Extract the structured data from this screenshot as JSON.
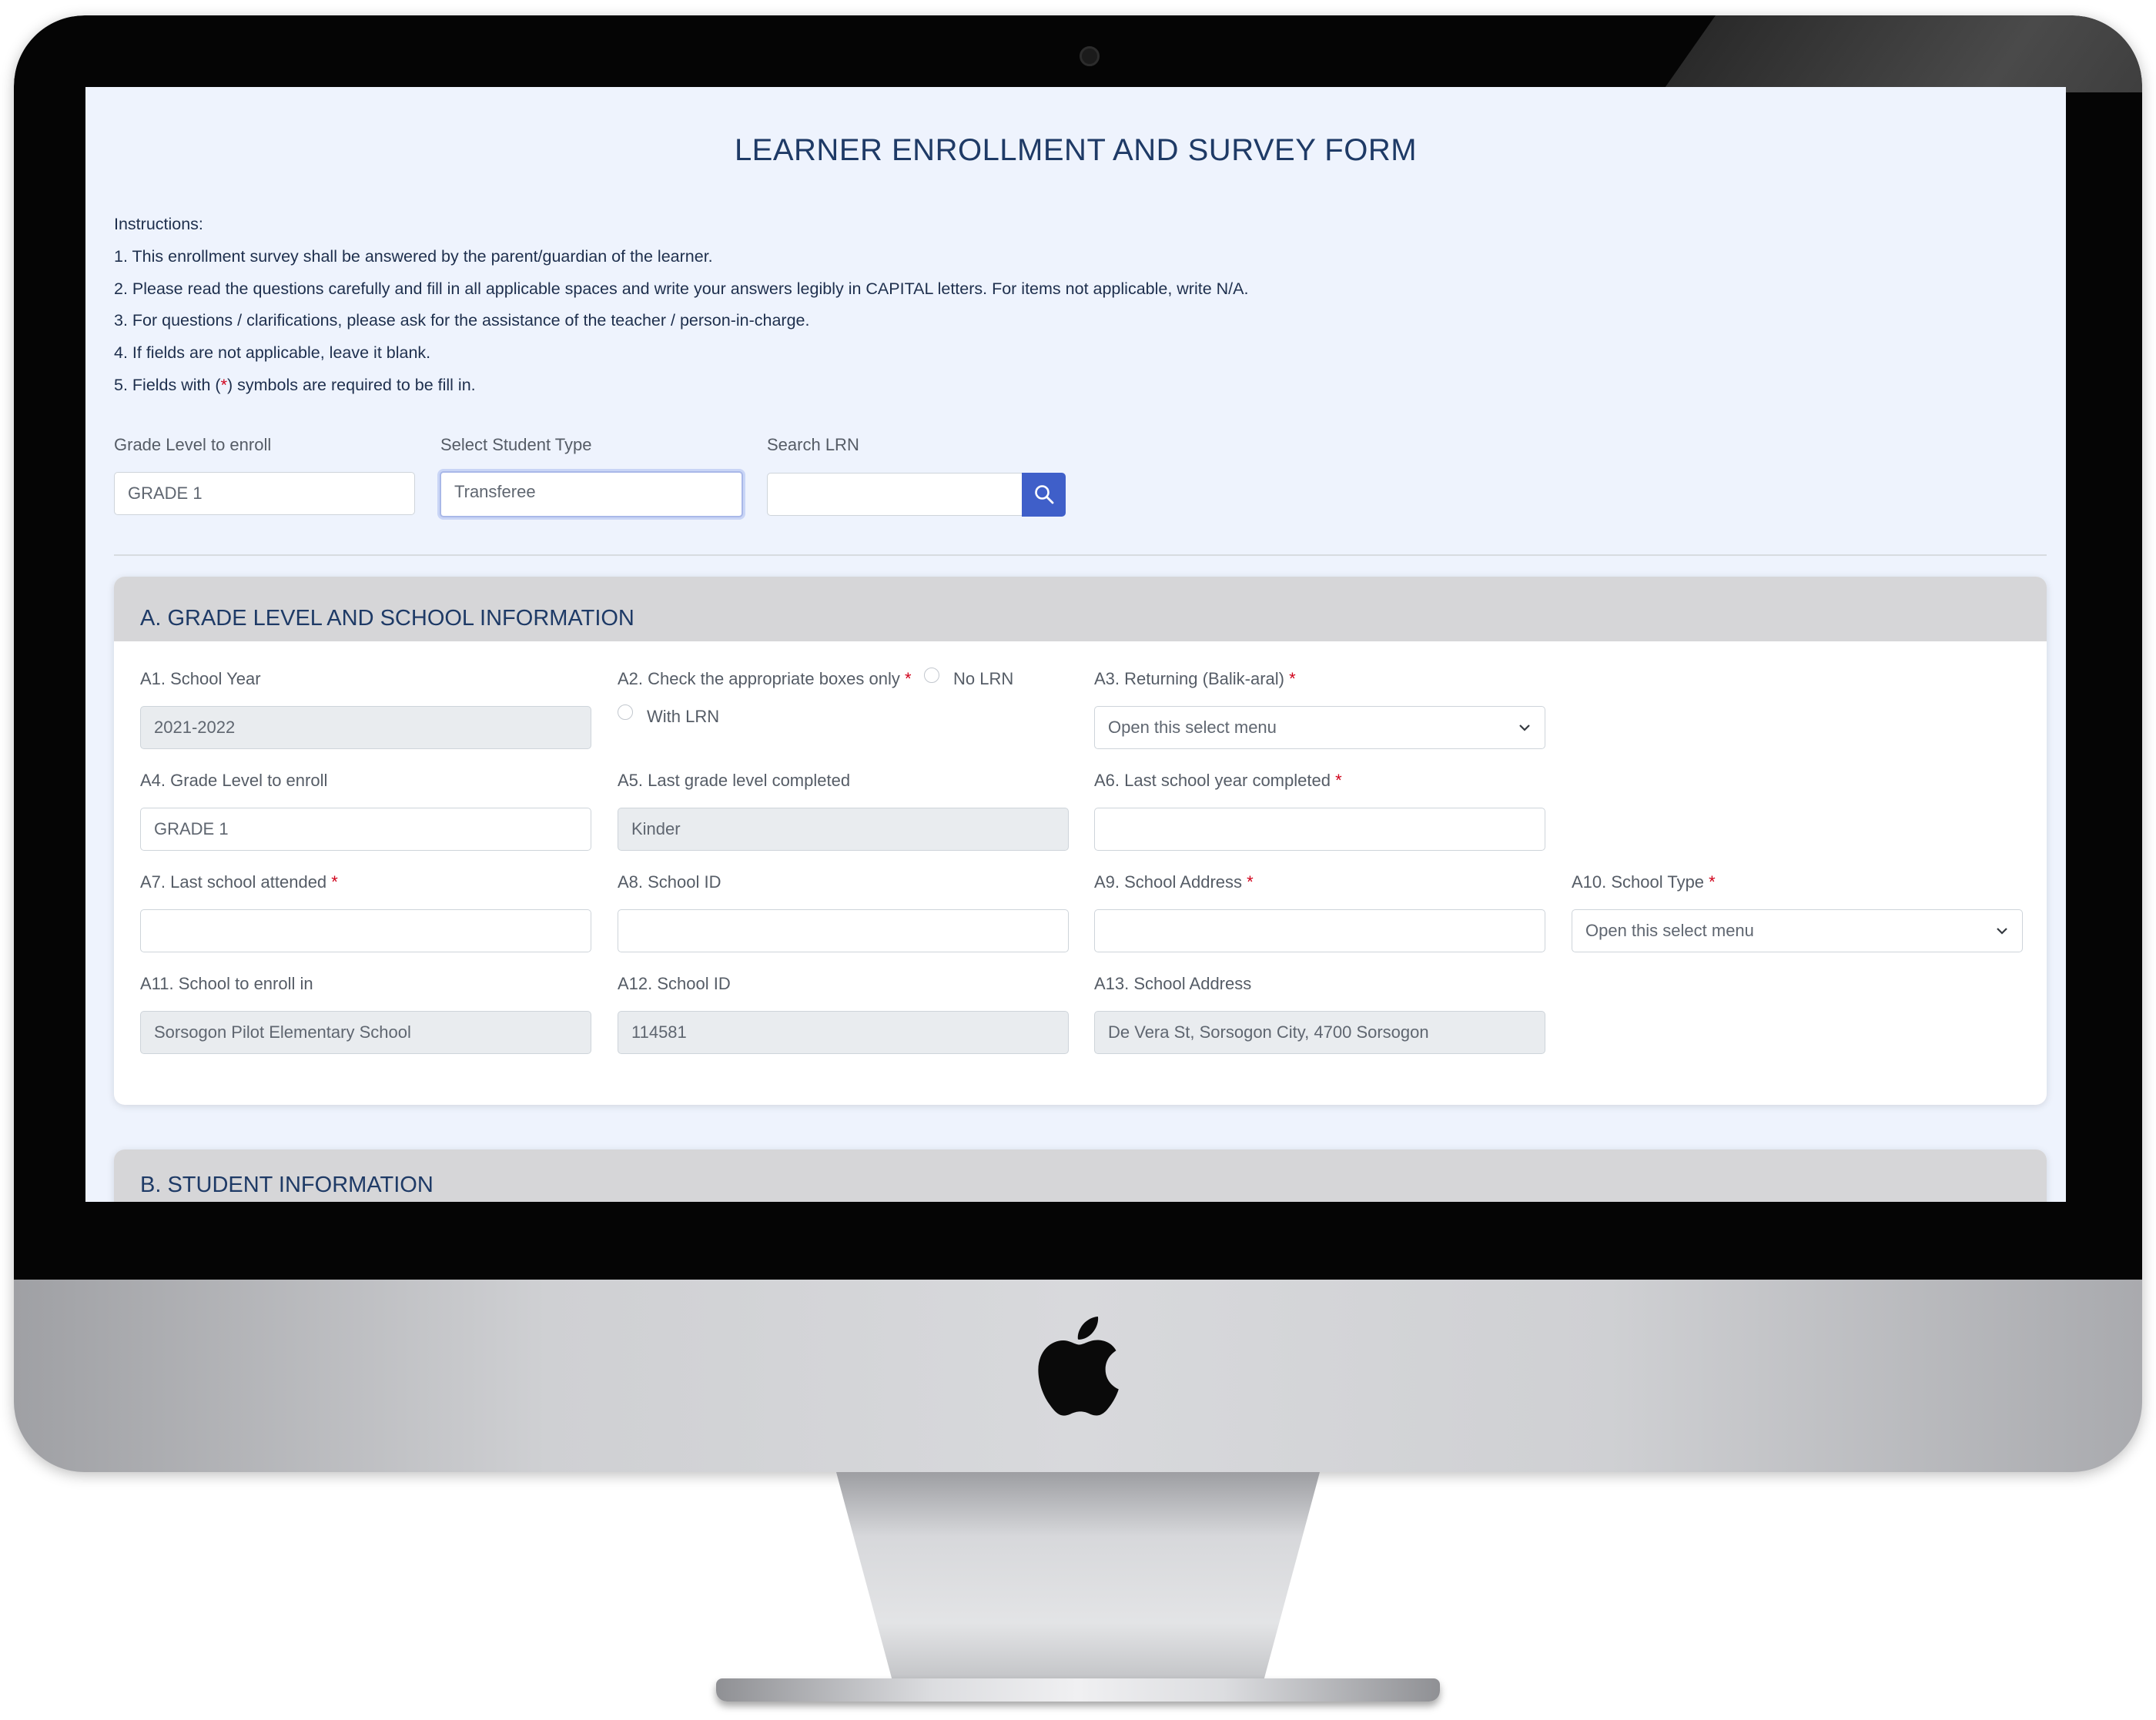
{
  "form": {
    "title": "LEARNER ENROLLMENT AND SURVEY FORM",
    "instructions_heading": "Instructions:",
    "instructions": [
      "1. This enrollment survey shall be answered by the parent/guardian of the learner.",
      "2. Please read the questions carefully and fill in all applicable spaces and write your answers legibly in CAPITAL letters. For items not applicable, write N/A.",
      "3. For questions / clarifications, please ask for the assistance of the teacher / person-in-charge.",
      "4. If fields are not applicable, leave it blank."
    ],
    "instruction5_prefix": "5. Fields with (",
    "instruction5_star": "*",
    "instruction5_suffix": ") symbols are required to be fill in.",
    "required_mark": "*"
  },
  "top": {
    "grade_label": "Grade Level to enroll",
    "grade_value": "GRADE 1",
    "student_type_label": "Select Student Type",
    "student_type_value": "Transferee",
    "lrn_label": "Search LRN",
    "lrn_value": ""
  },
  "section_a": {
    "title": "A. GRADE LEVEL AND SCHOOL INFORMATION",
    "a1_label": "A1. School Year",
    "a1_value": "2021-2022",
    "a2_label": "A2. Check the appropriate boxes only",
    "a2_option1": "No LRN",
    "a2_option2": "With LRN",
    "a3_label": "A3. Returning (Balik-aral)",
    "a3_value": "Open this select menu",
    "a4_label": "A4. Grade Level to enroll",
    "a4_value": "GRADE 1",
    "a5_label": "A5. Last grade level completed",
    "a5_value": "Kinder",
    "a6_label": "A6. Last school year completed",
    "a6_value": "",
    "a7_label": "A7. Last school attended",
    "a7_value": "",
    "a8_label": "A8. School ID",
    "a8_value": "",
    "a9_label": "A9. School Address",
    "a9_value": "",
    "a10_label": "A10. School Type",
    "a10_value": "Open this select menu",
    "a11_label": "A11. School to enroll in",
    "a11_value": "Sorsogon Pilot Elementary School",
    "a12_label": "A12. School ID",
    "a12_value": "114581",
    "a13_label": "A13. School Address",
    "a13_value": "De Vera St, Sorsogon City, 4700 Sorsogon"
  },
  "section_b": {
    "title": "B. STUDENT INFORMATION"
  },
  "icons": {
    "search": "search-icon",
    "chevron": "chevron-down-icon",
    "apple": "apple-logo-icon"
  },
  "colors": {
    "accent": "#3f5fc9",
    "title": "#1e3a66",
    "required": "#d0021b",
    "screen_bg": "#eef3fd",
    "card_header_bg": "#d6d6d8"
  }
}
